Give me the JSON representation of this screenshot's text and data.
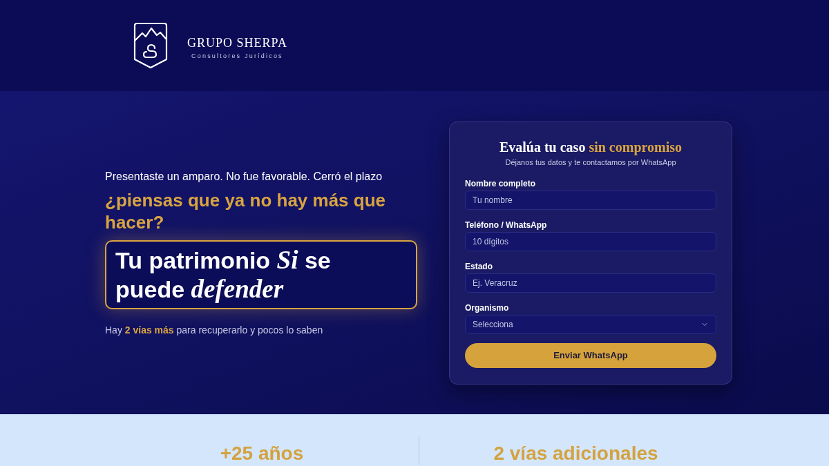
{
  "header": {
    "logo": {
      "name": "GRUPO SHERPA",
      "tagline": "Consultores Jurídicos"
    }
  },
  "hero": {
    "intro": "Presentaste un amparo. No fue favorable. Cerró el plazo",
    "question": "¿piensas que ya no hay más que hacer?",
    "headline": "Tu patrimonio *Si* se puede *defender*",
    "note": "Hay **2 vías más** para recuperarlo y pocos lo saben"
  },
  "form": {
    "title": "Evalúa tu caso",
    "title_accent": "sin compromiso",
    "subtitle": "Déjanos tus datos y te contactamos por WhatsApp",
    "fields": [
      {
        "kind": "text",
        "label": "Nombre completo",
        "placeholder": "Tu nombre"
      },
      {
        "kind": "text",
        "label": "Teléfono / WhatsApp",
        "placeholder": "10 dígitos"
      },
      {
        "kind": "text",
        "label": "Estado",
        "placeholder": "Ej. Veracruz"
      },
      {
        "kind": "select",
        "label": "Organismo",
        "placeholder": "Selecciona"
      }
    ],
    "submit": "Enviar WhatsApp"
  },
  "stats": [
    {
      "value": "+25 años"
    },
    {
      "value": "2 vías adicionales"
    }
  ]
}
